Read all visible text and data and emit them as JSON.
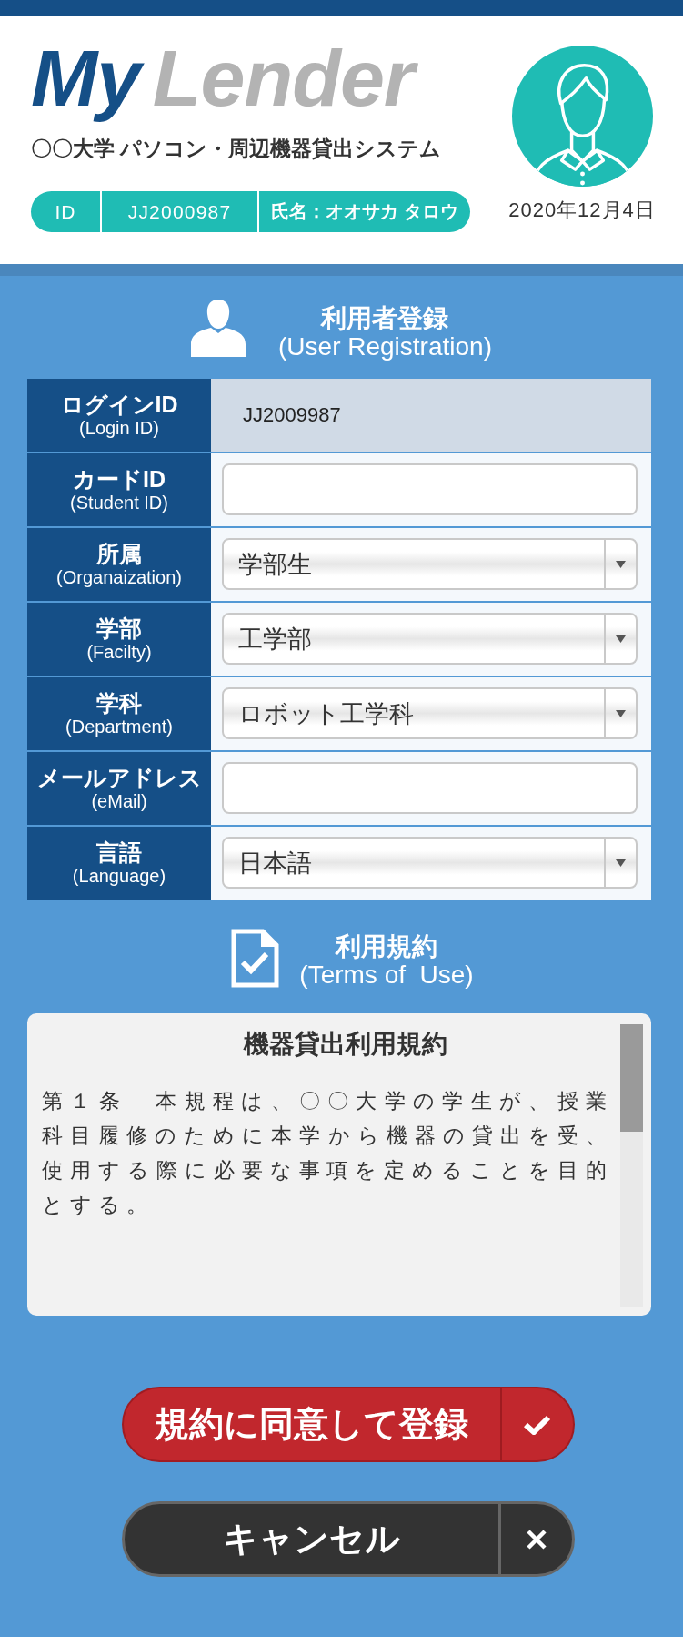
{
  "header": {
    "logo": {
      "word_1": "My",
      "word_2": "Lender"
    },
    "subtitle": "〇〇大学 パソコン・周辺機器貸出システム",
    "user_badge": {
      "id_label": "ID",
      "id_value": "JJ2000987",
      "name": "氏名：オオサカ タロウ"
    },
    "date": "2020年12月4日"
  },
  "registration": {
    "title": "利用者登録",
    "subtitle": "(User Registration)",
    "fields": [
      {
        "kind": "readonly",
        "label": "ログインID",
        "sublabel": "(Login ID)",
        "value": "JJ2009987"
      },
      {
        "kind": "text",
        "label": "カードID",
        "sublabel": "(Student ID)"
      },
      {
        "kind": "select",
        "label": "所属",
        "sublabel": "(Organaization)",
        "value": "学部生"
      },
      {
        "kind": "select",
        "label": "学部",
        "sublabel": "(Facilty)",
        "value": "工学部"
      },
      {
        "kind": "select",
        "label": "学科",
        "sublabel": "(Department)",
        "value": "ロボット工学科"
      },
      {
        "kind": "text",
        "label": "メールアドレス",
        "sublabel": "(eMail)"
      },
      {
        "kind": "select",
        "label": "言語",
        "sublabel": "(Language)",
        "value": "日本語"
      }
    ]
  },
  "terms": {
    "title": "利用規約",
    "subtitle": "(Terms of  Use)",
    "document": {
      "heading": "機器貸出利用規約",
      "body": "第１条　本規程は、〇〇大学の学生が、授業科目履修のために本学から機器の貸出を受、使用する際に必要な事項を定めることを目的とする。"
    }
  },
  "buttons": [
    {
      "kind": "confirm",
      "label": "規約に同意して登録"
    },
    {
      "kind": "cancel",
      "label": "キャンセル"
    }
  ]
}
